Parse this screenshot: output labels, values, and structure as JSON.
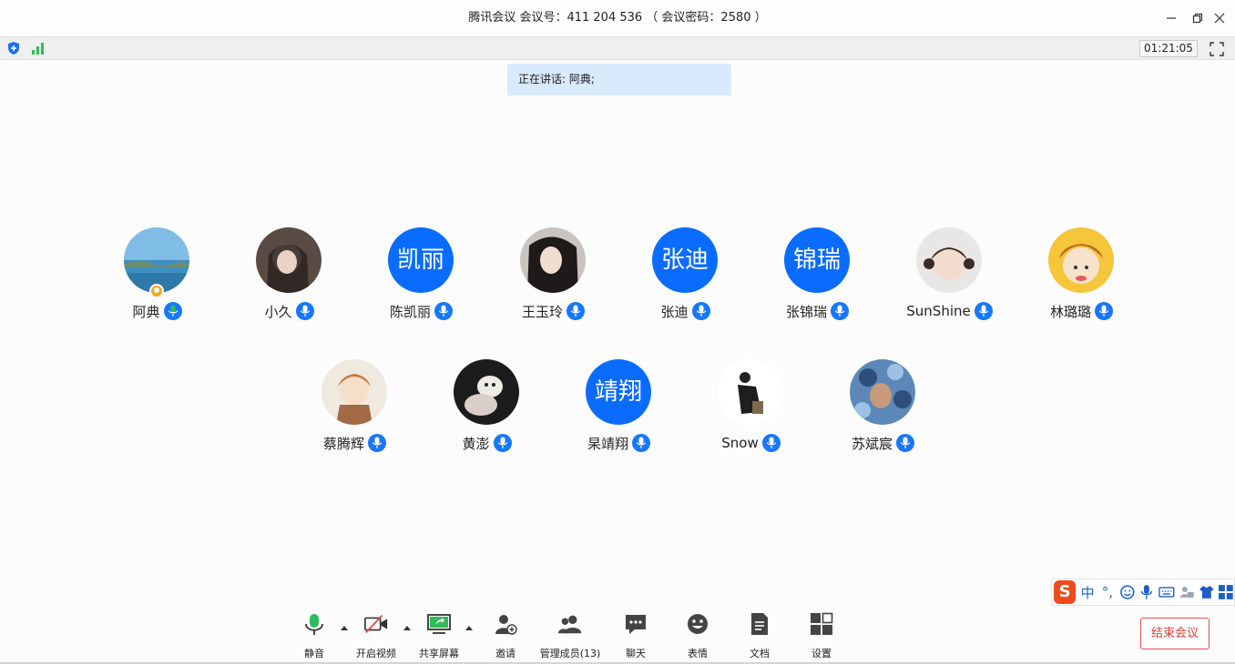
{
  "window": {
    "title": "腾讯会议 会议号：411 204 536 （ 会议密码：2580 ）"
  },
  "status": {
    "timer": "01:21:05"
  },
  "speaking": {
    "text": "正在讲话: 阿典;"
  },
  "participants": [
    {
      "name": "阿典",
      "avatar_text": "",
      "host": true,
      "mic": "active"
    },
    {
      "name": "小久",
      "avatar_text": "",
      "mic": "on"
    },
    {
      "name": "陈凯丽",
      "avatar_text": "凯丽",
      "mic": "on"
    },
    {
      "name": "王玉玲",
      "avatar_text": "",
      "mic": "on"
    },
    {
      "name": "张迪",
      "avatar_text": "张迪",
      "mic": "on"
    },
    {
      "name": "张锦瑞",
      "avatar_text": "锦瑞",
      "mic": "on"
    },
    {
      "name": "SunShine",
      "avatar_text": "",
      "mic": "on"
    },
    {
      "name": "林璐璐",
      "avatar_text": "",
      "mic": "on"
    },
    {
      "name": "蔡腾辉",
      "avatar_text": "",
      "mic": "on"
    },
    {
      "name": "黄澎",
      "avatar_text": "",
      "mic": "on"
    },
    {
      "name": "杲靖翔",
      "avatar_text": "靖翔",
      "mic": "on"
    },
    {
      "name": "Snow",
      "avatar_text": "",
      "mic": "on"
    },
    {
      "name": "苏斌宸",
      "avatar_text": "",
      "mic": "on"
    }
  ],
  "ime": {
    "logo": "S",
    "lang": "中",
    "punct": "°,"
  },
  "toolbar": {
    "mute": "静音",
    "video": "开启视频",
    "share": "共享屏幕",
    "invite": "邀请",
    "members": "管理成员(13)",
    "chat": "聊天",
    "emoji": "表情",
    "docs": "文档",
    "settings": "设置"
  },
  "end_button": "结束会议",
  "colors": {
    "accent": "#0a6cff",
    "mic_active": "#2ebd59",
    "end_red": "#e03a3a",
    "speaking_bg": "#d9eafc"
  }
}
